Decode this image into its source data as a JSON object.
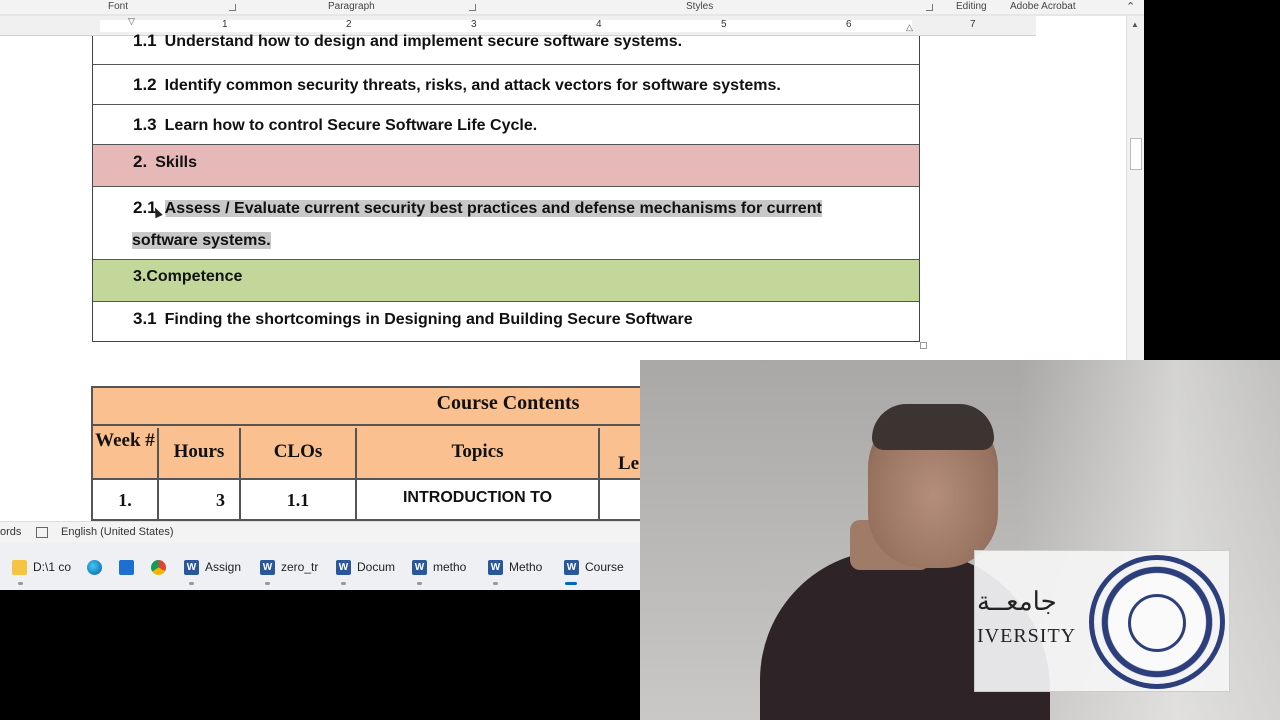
{
  "ribbon": {
    "groups": [
      "Font",
      "Paragraph",
      "Styles",
      "Editing",
      "Adobe Acrobat"
    ]
  },
  "ruler": {
    "labels": [
      "1",
      "2",
      "3",
      "4",
      "5",
      "6",
      "7"
    ]
  },
  "outcomes": {
    "rows": [
      {
        "num": "1.1",
        "text": "Understand how to design and implement secure software systems."
      },
      {
        "num": "1.2",
        "text": "Identify common security threats, risks, and attack vectors for software systems."
      },
      {
        "num": "1.3",
        "text": "Learn how to control Secure Software Life Cycle."
      },
      {
        "num": "2.",
        "text": "Skills"
      },
      {
        "num": "2.1",
        "text": "Assess / Evaluate current security best practices and defense mechanisms for current",
        "text2": "software systems."
      },
      {
        "num": "",
        "text": "3.Competence"
      },
      {
        "num": "3.1",
        "text": "Finding the shortcomings in Designing and Building Secure Software"
      }
    ],
    "colors": {
      "skills_row": "#e6b8b7",
      "competence_row": "#c4d79b",
      "selection": "#c8c8c8"
    }
  },
  "course_contents": {
    "title": "Course Contents",
    "headers": [
      "Week #",
      "Hours",
      "CLOs",
      "Topics",
      "Le"
    ],
    "first_row": {
      "week": "1.",
      "hours": "3",
      "clos": "1.1",
      "topic": "INTRODUCTION TO"
    },
    "header_color": "#fac090"
  },
  "statusbar": {
    "words": "ords",
    "language": "English (United States)"
  },
  "taskbar": {
    "items": [
      {
        "label": "D:\\1 co",
        "icon": "folder-icon"
      },
      {
        "label": "",
        "icon": "edge-icon"
      },
      {
        "label": "",
        "icon": "store-icon"
      },
      {
        "label": "",
        "icon": "chrome-icon"
      },
      {
        "label": "Assign",
        "icon": "word-icon"
      },
      {
        "label": "zero_tr",
        "icon": "word-icon"
      },
      {
        "label": "Docum",
        "icon": "word-icon"
      },
      {
        "label": "metho",
        "icon": "word-icon"
      },
      {
        "label": "Metho",
        "icon": "word-icon"
      },
      {
        "label": "Course",
        "icon": "word-icon"
      }
    ]
  },
  "webcam": {
    "logo_arabic": "جامعــة",
    "logo_english": "IVERSITY"
  }
}
